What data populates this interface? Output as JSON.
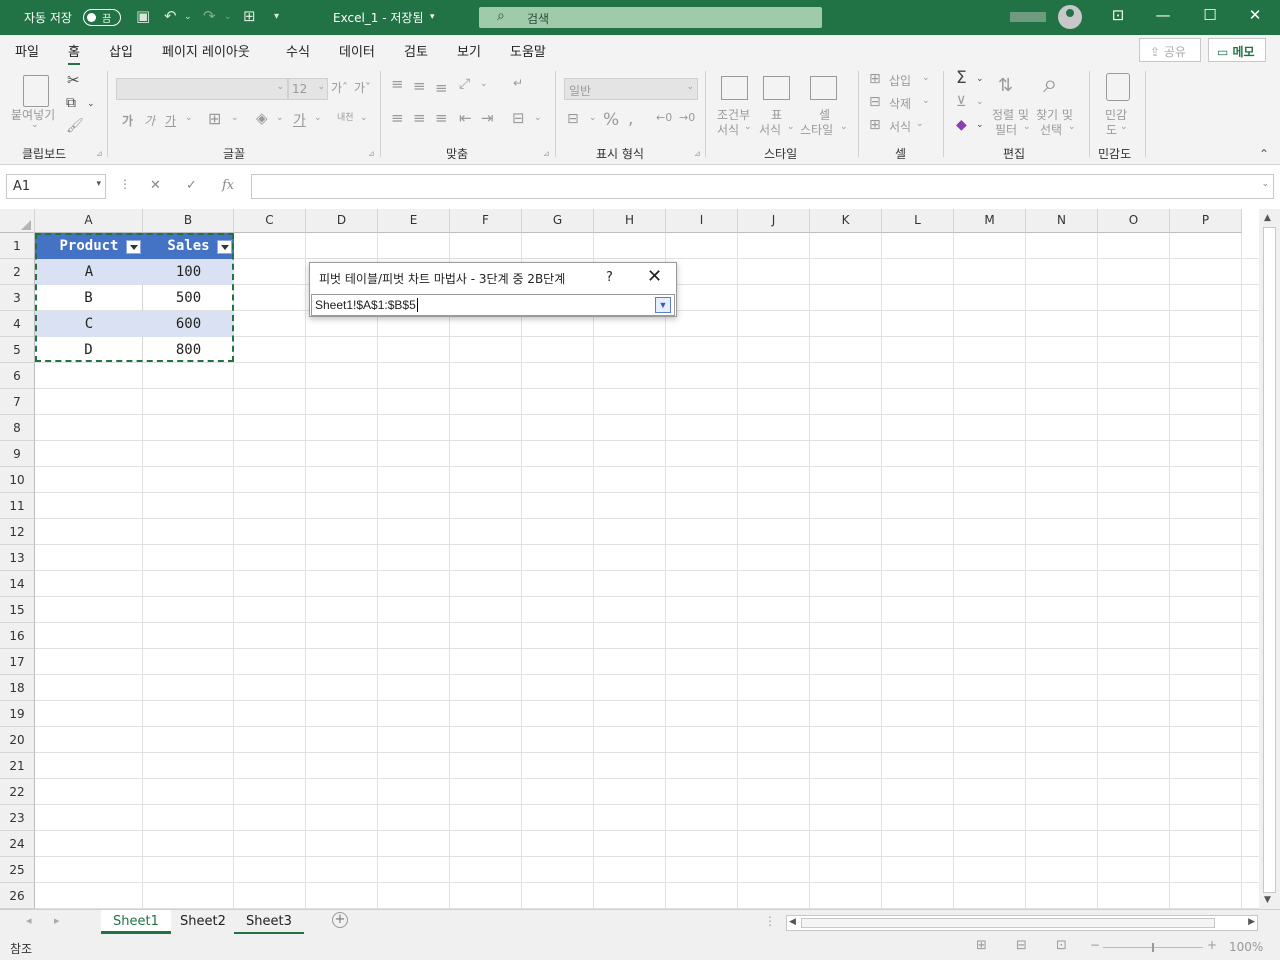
{
  "titlebar": {
    "autosave_label": "자동 저장",
    "autosave_state": "끔",
    "doc_title": "Excel_1 - 저장됨",
    "search_placeholder": "검색"
  },
  "ribbon_tabs": [
    "파일",
    "홈",
    "삽입",
    "페이지 레이아웃",
    "수식",
    "데이터",
    "검토",
    "보기",
    "도움말"
  ],
  "active_tab": "홈",
  "share_label": "공유",
  "memo_label": "메모",
  "ribbon": {
    "clipboard": {
      "paste": "붙여넣기",
      "label": "클립보드"
    },
    "font": {
      "size": "12",
      "label": "글꼴",
      "bold": "가",
      "italic": "가",
      "underline": "가"
    },
    "alignment": {
      "label": "맞춤"
    },
    "number": {
      "format": "일반",
      "label": "표시 형식"
    },
    "styles": {
      "cond": [
        "조건부",
        "서식"
      ],
      "table": [
        "표",
        "서식"
      ],
      "cell": [
        "셀",
        "스타일"
      ],
      "label": "스타일"
    },
    "cells": {
      "insert": "삽입",
      "delete": "삭제",
      "format": "서식",
      "label": "셀"
    },
    "editing": {
      "sort": [
        "정렬 및",
        "필터"
      ],
      "find": [
        "찾기 및",
        "선택"
      ],
      "label": "편집"
    },
    "sensitivity": {
      "name": [
        "민감",
        "도"
      ],
      "label": "민감도"
    }
  },
  "namebox": "A1",
  "fx": "fx",
  "columns": [
    "A",
    "B",
    "C",
    "D",
    "E",
    "F",
    "G",
    "H",
    "I",
    "J",
    "K",
    "L",
    "M",
    "N",
    "O",
    "P"
  ],
  "rows": [
    "1",
    "2",
    "3",
    "4",
    "5",
    "6",
    "7",
    "8",
    "9",
    "10",
    "11",
    "12",
    "13",
    "14",
    "15",
    "16",
    "17",
    "18",
    "19",
    "20",
    "21",
    "22",
    "23",
    "24",
    "25",
    "26"
  ],
  "table": {
    "headers": [
      "Product",
      "Sales"
    ],
    "rows": [
      [
        "A",
        "100"
      ],
      [
        "B",
        "500"
      ],
      [
        "C",
        "600"
      ],
      [
        "D",
        "800"
      ]
    ]
  },
  "dialog": {
    "title": "피벗 테이블/피벗 차트 마법사 - 3단계 중 2B단계",
    "help": "?",
    "range": "Sheet1!$A$1:$B$5"
  },
  "sheets": [
    "Sheet1",
    "Sheet2",
    "Sheet3"
  ],
  "active_sheet": "Sheet1",
  "status": {
    "mode": "참조",
    "zoom": "100%"
  }
}
